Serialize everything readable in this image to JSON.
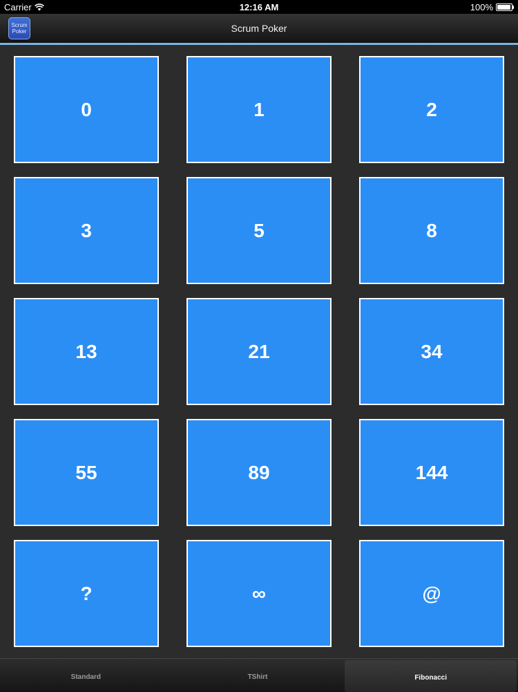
{
  "status_bar": {
    "carrier": "Carrier",
    "time": "12:16 AM",
    "battery": "100%"
  },
  "nav_bar": {
    "title": "Scrum Poker",
    "app_icon_line1": "Scrum",
    "app_icon_line2": "Poker"
  },
  "cards": [
    {
      "label": "0"
    },
    {
      "label": "1"
    },
    {
      "label": "2"
    },
    {
      "label": "3"
    },
    {
      "label": "5"
    },
    {
      "label": "8"
    },
    {
      "label": "13"
    },
    {
      "label": "21"
    },
    {
      "label": "34"
    },
    {
      "label": "55"
    },
    {
      "label": "89"
    },
    {
      "label": "144"
    },
    {
      "label": "?"
    },
    {
      "label": "∞"
    },
    {
      "label": "@"
    }
  ],
  "tabs": [
    {
      "label": "Standard",
      "selected": false
    },
    {
      "label": "TShirt",
      "selected": false
    },
    {
      "label": "Fibonacci",
      "selected": true
    }
  ],
  "colors": {
    "card": "#2b8ef5",
    "card_border": "#ffffff",
    "accent_line": "#7ab4e6",
    "background": "#2c2c2c"
  },
  "icons": [
    "wifi-icon",
    "battery-icon",
    "app-icon"
  ]
}
